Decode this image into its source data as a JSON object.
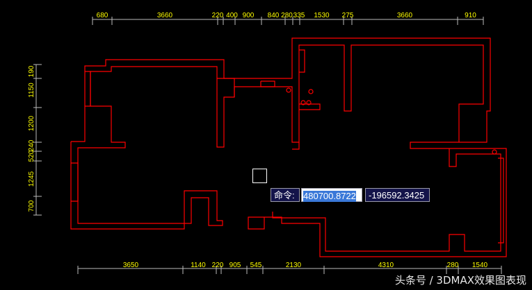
{
  "dims_top": [
    "680",
    "3660",
    "220",
    "400",
    "900",
    "840",
    "280",
    "335",
    "1530",
    "275",
    "3660",
    "910"
  ],
  "dims_bottom": [
    "3650",
    "1140",
    "220",
    "905",
    "545",
    "2130",
    "4310",
    "280",
    "1540"
  ],
  "dims_left": [
    "190",
    "1150",
    "1200",
    "240",
    "520",
    "1245",
    "700"
  ],
  "command": {
    "label": "命令:",
    "x_value": "480700.8722",
    "y_value": "-196592.3425"
  },
  "watermark": "头条号 / 3DMAX效果图表现",
  "colors": {
    "wall": "#ff0000",
    "dimension": "#ffff00",
    "dimline": "#c0c0c0"
  }
}
